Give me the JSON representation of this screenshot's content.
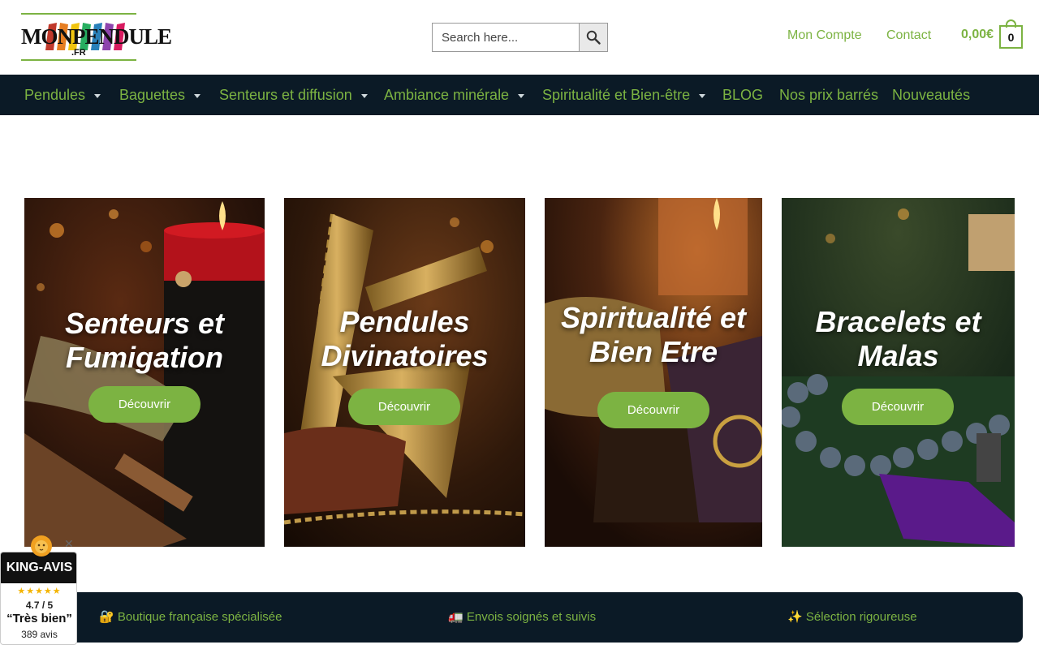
{
  "header": {
    "logo_text": "MONPENDULE",
    "logo_tld": ".FR",
    "search_placeholder": "Search here...",
    "account_label": "Mon Compte",
    "contact_label": "Contact",
    "cart_total": "0,00€",
    "cart_count": "0"
  },
  "nav": {
    "items": [
      {
        "label": "Pendules",
        "has_dropdown": true
      },
      {
        "label": "Baguettes",
        "has_dropdown": true
      },
      {
        "label": "Senteurs et diffusion",
        "has_dropdown": true
      },
      {
        "label": "Ambiance minérale",
        "has_dropdown": true
      },
      {
        "label": "Spiritualité et Bien-être",
        "has_dropdown": true
      },
      {
        "label": "BLOG",
        "has_dropdown": false
      },
      {
        "label": "Nos prix barrés",
        "has_dropdown": false
      },
      {
        "label": "Nouveautés",
        "has_dropdown": false
      }
    ]
  },
  "cards": [
    {
      "title_line1": "Senteurs et",
      "title_line2": "Fumigation",
      "button": "Découvrir"
    },
    {
      "title_line1": "Pendules",
      "title_line2": "Divinatoires",
      "button": "Découvrir"
    },
    {
      "title_line1": "Spiritualité et",
      "title_line2": "Bien Etre",
      "button": "Découvrir"
    },
    {
      "title_line1": "Bracelets et",
      "title_line2": "Malas",
      "button": "Découvrir"
    }
  ],
  "features": [
    {
      "icon": "🔐",
      "label": "Boutique française spécialisée"
    },
    {
      "icon": "🚛",
      "label": "Envois soignés et suivis"
    },
    {
      "icon": "✨",
      "label": "Sélection rigoureuse"
    }
  ],
  "king_avis": {
    "brand": "KING-AVIS",
    "stars": "★★★★★",
    "score": "4.7 / 5",
    "verdict": "“Très bien”",
    "count": "389 avis"
  },
  "colors": {
    "accent": "#7cb342",
    "nav_bg": "#0b1a26"
  }
}
